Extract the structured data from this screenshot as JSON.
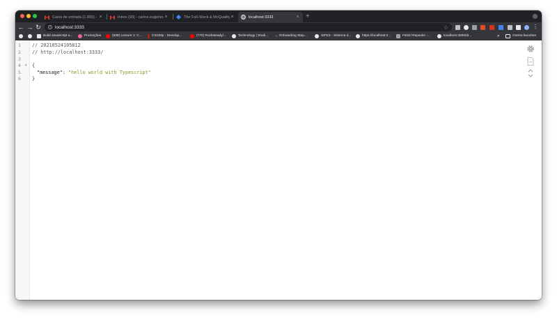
{
  "tabs": [
    {
      "label": "Caixa de entrada (1.800) - car...",
      "icon": "gmail-icon"
    },
    {
      "label": "Inbox (93) - carlos.eugenio@y...",
      "icon": "gmail-icon"
    },
    {
      "label": "The Full-Stack & McQuality - ...",
      "icon": "diamond-icon"
    },
    {
      "label": "localhost:3333",
      "icon": "globe-icon",
      "active": true
    }
  ],
  "toolbar": {
    "url": "localhost:3333"
  },
  "bookmarks": [
    {
      "label": "Build JavaScript a..."
    },
    {
      "label": "Promoções"
    },
    {
      "label": "(638) Lecture 1: C..."
    },
    {
      "label": "CS193p - Develop..."
    },
    {
      "label": "(770) Rocksteady/..."
    },
    {
      "label": "Technology | Studi..."
    },
    {
      "label": "Onboarding Step..."
    },
    {
      "label": "SIFES - Sistema d..."
    },
    {
      "label": "https://localhost:3..."
    },
    {
      "label": "FitGirl Repacks -..."
    },
    {
      "label": "localhost:3000/dr..."
    }
  ],
  "bookmarks_more": "»",
  "other_bookmarks": "Outros favoritos",
  "editor": {
    "line_numbers": [
      "1",
      "2",
      "3",
      "4",
      "5",
      "6"
    ],
    "comment1": "// 20210524105812",
    "comment2": "// http://localhost:3333/",
    "open_brace": "{",
    "key": "\"message\"",
    "colon": ": ",
    "value": "\"hello world with Typescript\"",
    "close_brace": "}"
  },
  "colors": {
    "accent_close": "#ff5f57",
    "accent_min": "#febc2e",
    "accent_max": "#28c840",
    "string": "#7a9a1d"
  }
}
